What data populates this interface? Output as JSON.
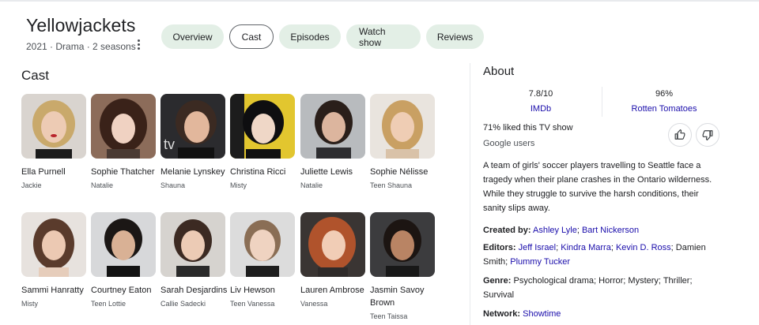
{
  "header": {
    "title": "Yellowjackets",
    "subtitle": "2021 · Drama · 2 seasons"
  },
  "tabs": [
    {
      "label": "Overview",
      "active": false
    },
    {
      "label": "Cast",
      "active": true
    },
    {
      "label": "Episodes",
      "active": false
    },
    {
      "label": "Watch show",
      "active": false
    },
    {
      "label": "Reviews",
      "active": false
    }
  ],
  "cast": {
    "heading": "Cast",
    "members": [
      {
        "name": "Ella Purnell",
        "role": "Jackie"
      },
      {
        "name": "Sophie Thatcher",
        "role": "Natalie"
      },
      {
        "name": "Melanie Lynskey",
        "role": "Shauna"
      },
      {
        "name": "Christina Ricci",
        "role": "Misty"
      },
      {
        "name": "Juliette Lewis",
        "role": "Natalie"
      },
      {
        "name": "Sophie Nélisse",
        "role": "Teen Shauna"
      },
      {
        "name": "Sammi Hanratty",
        "role": "Misty"
      },
      {
        "name": "Courtney Eaton",
        "role": "Teen Lottie"
      },
      {
        "name": "Sarah Desjardins",
        "role": "Callie Sadecki"
      },
      {
        "name": "Liv Hewson",
        "role": "Teen Vanessa"
      },
      {
        "name": "Lauren Ambrose",
        "role": "Vanessa"
      },
      {
        "name": "Jasmin Savoy Brown",
        "role": "Teen Taissa"
      }
    ]
  },
  "about": {
    "heading": "About",
    "ratings": [
      {
        "score": "7.8/10",
        "source": "IMDb"
      },
      {
        "score": "96%",
        "source": "Rotten Tomatoes"
      }
    ],
    "liked": "71% liked this TV show",
    "liked_source": "Google users",
    "description": "A team of girls' soccer players travelling to Seattle face a tragedy when their plane crashes in the Ontario wilderness. While they struggle to survive the harsh conditions, their sanity slips away.",
    "created_by_label": "Created by:",
    "created_by": [
      "Ashley Lyle",
      "Bart Nickerson"
    ],
    "editors_label": "Editors:",
    "editors_linked": [
      "Jeff Israel",
      "Kindra Marra",
      "Kevin D. Ross"
    ],
    "editors_plain": "Damien Smith",
    "editors_last": "Plummy Tucker",
    "genre_label": "Genre:",
    "genre": "Psychological drama; Horror; Mystery; Thriller; Survival",
    "network_label": "Network:",
    "network": "Showtime"
  },
  "icons": {
    "more": "more-vert-icon",
    "thumbs_up": "thumbs-up-icon",
    "thumbs_down": "thumbs-down-icon"
  },
  "colors": {
    "tab_bg": "#e3efe6",
    "link": "#1a0dab"
  }
}
